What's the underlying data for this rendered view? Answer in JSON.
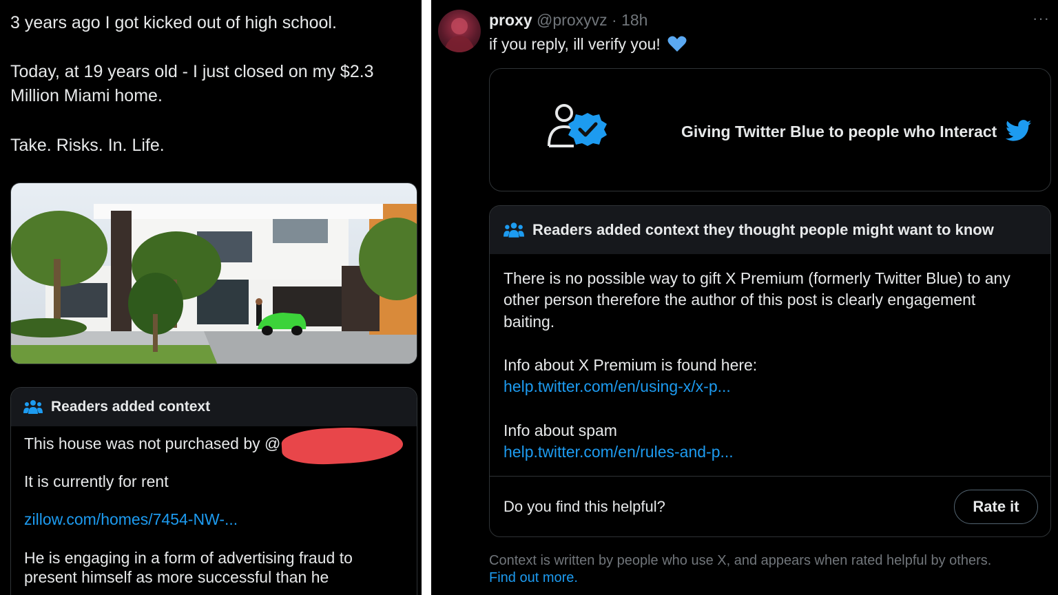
{
  "left_tweet": {
    "line1": "3 years ago I got kicked out of high school.",
    "line2a": "Today, at 19 years old - I just closed on my $2.3",
    "line2b": "Million Miami home.",
    "line3": "Take. Risks. In. Life.",
    "note": {
      "header": "Readers added context",
      "line1": "This house was not purchased by @",
      "line2": "It is currently for rent",
      "link": "zillow.com/homes/7454-NW-...",
      "line3a": "He is engaging in a form of advertising fraud to",
      "line3b": "present himself as more successful than he"
    }
  },
  "right_tweet": {
    "author": {
      "name": "proxy",
      "handle": "@proxyvz",
      "time": "· 18h"
    },
    "text": "if you reply, ill verify you!",
    "more_label": "···",
    "card": {
      "title": "Giving Twitter Blue to people who Interact"
    },
    "note": {
      "header": "Readers added context they thought people might want to know",
      "para1a": "There is no possible way to gift X Premium (formerly Twitter Blue) to any",
      "para1b": "other person therefore the author of this post is clearly engagement",
      "para1c": "baiting.",
      "info1": "Info about X Premium is found here:",
      "link1": "help.twitter.com/en/using-x/x-p...",
      "info2": "Info about spam",
      "link2": "help.twitter.com/en/rules-and-p...",
      "helpful_question": "Do you find this helpful?",
      "rate_button": "Rate it"
    },
    "footer": {
      "text": "Context is written by people who use X, and appears when rated helpful by others.",
      "link": "Find out more."
    }
  },
  "colors": {
    "background": "#000000",
    "text": "#e7e9ea",
    "muted": "#71767b",
    "link": "#1d9bf0",
    "border": "#2f3336",
    "redaction": "#e8464a"
  },
  "icons": [
    "people-icon",
    "verified-badge-icon",
    "person-outline-icon",
    "twitter-bird-icon",
    "heart-icon",
    "more-icon"
  ]
}
